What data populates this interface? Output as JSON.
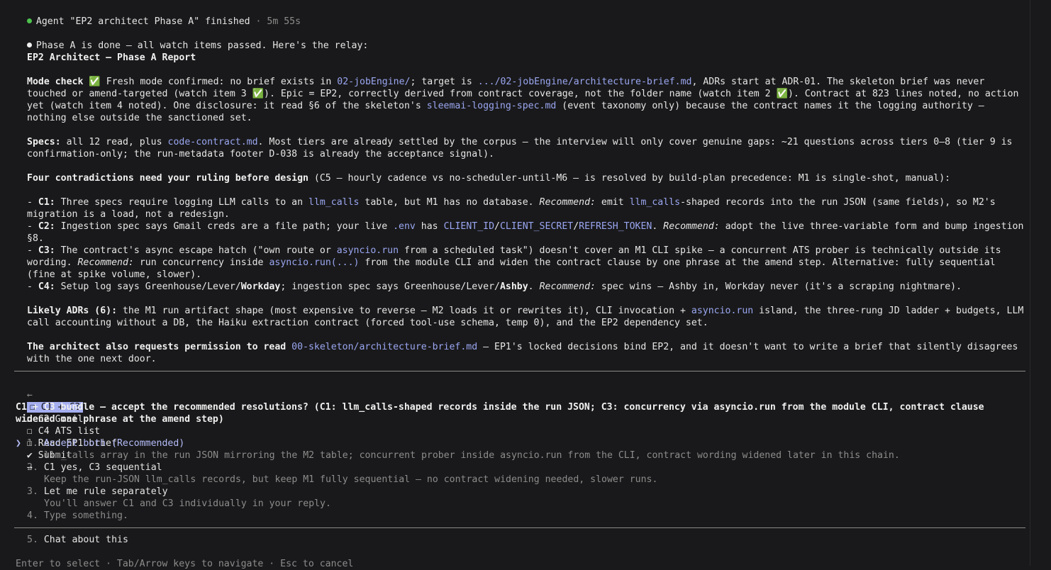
{
  "notice": {
    "text": "Agent \"EP2 architect Phase A\" finished",
    "sep": " · ",
    "elapsed": "5m 55s"
  },
  "intro": "Phase A is done — all watch items passed. Here's the relay:",
  "report_title": "EP2 Architect — Phase A Report",
  "mode": {
    "label": "Mode check",
    "icon": "✅",
    "t1": " Fresh mode confirmed: no brief exists in ",
    "l1": "02-jobEngine/",
    "t2": "; target is ",
    "l2": ".../02-jobEngine/architecture-brief.md",
    "t3": ", ADRs start at ADR-01. The skeleton brief was never touched or amend-targeted (watch item 3 ",
    "t4": "). Epic = EP2, correctly derived from contract coverage, not the folder name (watch item 2 ",
    "t5": "). Contract at 823 lines noted, no action yet (watch item 4 noted). One disclosure: it read §6 of the skeleton's ",
    "l3": "sleemai-logging-spec.md",
    "t6": " (event taxonomy only) because the contract names it the logging authority — nothing else outside the sanctioned set."
  },
  "specs": {
    "label": "Specs:",
    "t1": " all 12 read, plus ",
    "l1": "code-contract.md",
    "t2": ". Most tiers are already settled by the corpus — the interview will only cover genuine gaps: ~21 questions across tiers 0–8 (tier 9 is confirmation-only; the run-metadata footer D-038 is already the acceptance signal)."
  },
  "four": {
    "label": "Four contradictions need your ruling before design",
    "rest": " (C5 — hourly cadence vs no-scheduler-until-M6 — is resolved by build-plan precedence: M1 is single-shot, manual):"
  },
  "c1": {
    "pre": "- ",
    "label": "C1:",
    "t1": " Three specs require logging LLM calls to an ",
    "l1": "llm_calls",
    "t2": " table, but M1 has no database. ",
    "rec": "Recommend:",
    "t3": " emit ",
    "l2": "llm_calls",
    "t4": "-shaped records into the run JSON (same fields), so M2's migration is a load, not a redesign."
  },
  "c2": {
    "pre": "- ",
    "label": "C2:",
    "t1": " Ingestion spec says Gmail creds are a file path; your live ",
    "l1": ".env",
    "t2": " has ",
    "l2": "CLIENT_ID",
    "s1": "/",
    "l3": "CLIENT_SECRET",
    "s2": "/",
    "l4": "REFRESH_TOKEN",
    "t3": ". ",
    "rec": "Recommend:",
    "t4": " adopt the live three-variable form and bump ingestion §8."
  },
  "c3": {
    "pre": "- ",
    "label": "C3:",
    "t1": " The contract's async escape hatch (\"own route or ",
    "l1": "asyncio.run",
    "t2": " from a scheduled task\") doesn't cover an M1 CLI spike — a concurrent ATS prober is technically outside its wording. ",
    "rec": "Recommend:",
    "t3": " run concurrency inside ",
    "l2": "asyncio.run(...)",
    "t4": " from the module CLI and widen the contract clause by one phrase at the amend step. Alternative: fully sequential (fine at spike volume, slower)."
  },
  "c4": {
    "pre": "- ",
    "label": "C4:",
    "t1": " Setup log says Greenhouse/Lever/",
    "b1": "Workday",
    "t2": "; ingestion spec says Greenhouse/Lever/",
    "b2": "Ashby",
    "t3": ". ",
    "rec": "Recommend:",
    "t4": " spec wins — Ashby in, Workday never (it's a scraping nightmare)."
  },
  "adrs": {
    "label": "Likely ADRs (6):",
    "t1": " the M1 run artifact shape (most expensive to reverse — M2 loads it or rewrites it), CLI invocation + ",
    "l1": "asyncio.run",
    "t2": " island, the three-rung JD ladder + budgets, LLM call accounting without a DB, the Haiku extraction contract (forced tool-use schema, temp 0), and the EP2 dependency set."
  },
  "perm": {
    "label": "The architect also requests permission to read ",
    "l1": "00-skeleton/architecture-brief.md",
    "t1": " — EP1's locked decisions bind EP2, and it doesn't want to write a brief that silently disagrees with the one next door."
  },
  "tabs": {
    "left_arrow": "←",
    "items": [
      "☐ C1 + C3",
      "☐ C2 Gmail",
      "☐ C4 ATS list",
      "☐ Read EP1 brief",
      "✔ Submit"
    ],
    "right_arrow": "→"
  },
  "question": "C1 + C3 bundle — accept the recommended resolutions? (C1: llm_calls-shaped records inside the run JSON; C3: concurrency via asyncio.run from the module CLI, contract clause widened one phrase at the amend step)",
  "options": [
    {
      "cursor": "❯",
      "num": "1.",
      "label": "Accept both (Recommended)",
      "desc": "llm_calls array in the run JSON mirroring the M2 table; concurrent prober inside asyncio.run from the CLI, contract wording widened later in this chain."
    },
    {
      "num": "2.",
      "label": "C1 yes, C3 sequential",
      "desc": "Keep the run-JSON llm_calls records, but keep M1 fully sequential — no contract widening needed, slower runs."
    },
    {
      "num": "3.",
      "label": "Let me rule separately",
      "desc": "You'll answer C1 and C3 individually in your reply."
    },
    {
      "num": "4.",
      "label": "Type something."
    }
  ],
  "chat_option": {
    "num": "5.",
    "label": "Chat about this"
  },
  "footer": "Enter to select · Tab/Arrow keys to navigate · Esc to cancel",
  "colors": {
    "background": "#19191b",
    "link": "#9aa6f0",
    "success": "#5ccf5c",
    "tab_selected": "#a5aff0",
    "dim": "#8c8c8c"
  }
}
